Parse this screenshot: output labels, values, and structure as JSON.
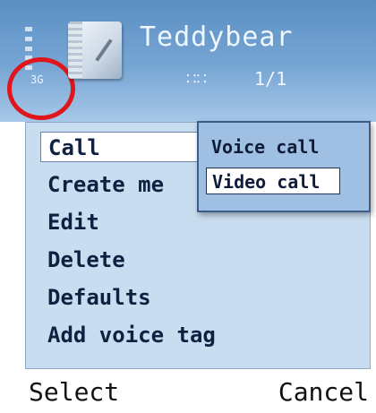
{
  "header": {
    "network_label": "3G",
    "contact_name": "Teddybear",
    "group_icon": "group-icon",
    "page_count": "1/1"
  },
  "options_menu": {
    "items": [
      {
        "label": "Call",
        "selected": true
      },
      {
        "label": "Create me"
      },
      {
        "label": "Edit"
      },
      {
        "label": "Delete"
      },
      {
        "label": "Defaults"
      },
      {
        "label": "Add voice tag"
      }
    ]
  },
  "call_submenu": {
    "items": [
      {
        "label": "Voice call"
      },
      {
        "label": "Video call",
        "selected": true
      }
    ]
  },
  "softkeys": {
    "left": "Select",
    "right": "Cancel"
  },
  "colors": {
    "header_blue": "#5a8fc3",
    "panel_blue": "#c9ddf0",
    "submenu_blue": "#9fc0e3",
    "highlight_ring": "#e0161c"
  }
}
